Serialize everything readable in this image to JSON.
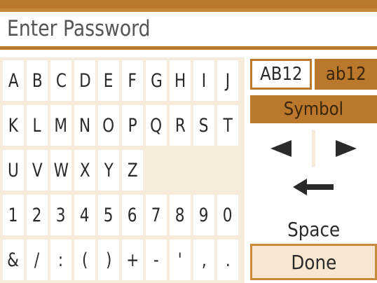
{
  "input": {
    "placeholder": "Enter Password",
    "value": ""
  },
  "keyboard": {
    "rows": [
      [
        "A",
        "B",
        "C",
        "D",
        "E",
        "F",
        "G",
        "H",
        "I",
        "J"
      ],
      [
        "K",
        "L",
        "M",
        "N",
        "O",
        "P",
        "Q",
        "R",
        "S",
        "T"
      ],
      [
        "U",
        "V",
        "W",
        "X",
        "Y",
        "Z"
      ],
      [
        "1",
        "2",
        "3",
        "4",
        "5",
        "6",
        "7",
        "8",
        "9",
        "0"
      ],
      [
        "&",
        "/",
        ":",
        "(",
        ")",
        "+",
        "-",
        "'",
        ",",
        "."
      ]
    ]
  },
  "modes": {
    "upper": "AB12",
    "lower": "ab12",
    "symbol": "Symbol",
    "selected": "upper"
  },
  "controls": {
    "left_icon": "arrow-left-icon",
    "right_icon": "arrow-right-icon",
    "backspace_icon": "backspace-arrow-icon",
    "space_label": "Space",
    "done_label": "Done"
  },
  "colors": {
    "accent": "#b9782c",
    "panel": "#f7ebdc",
    "text": "#2a2a2a"
  }
}
